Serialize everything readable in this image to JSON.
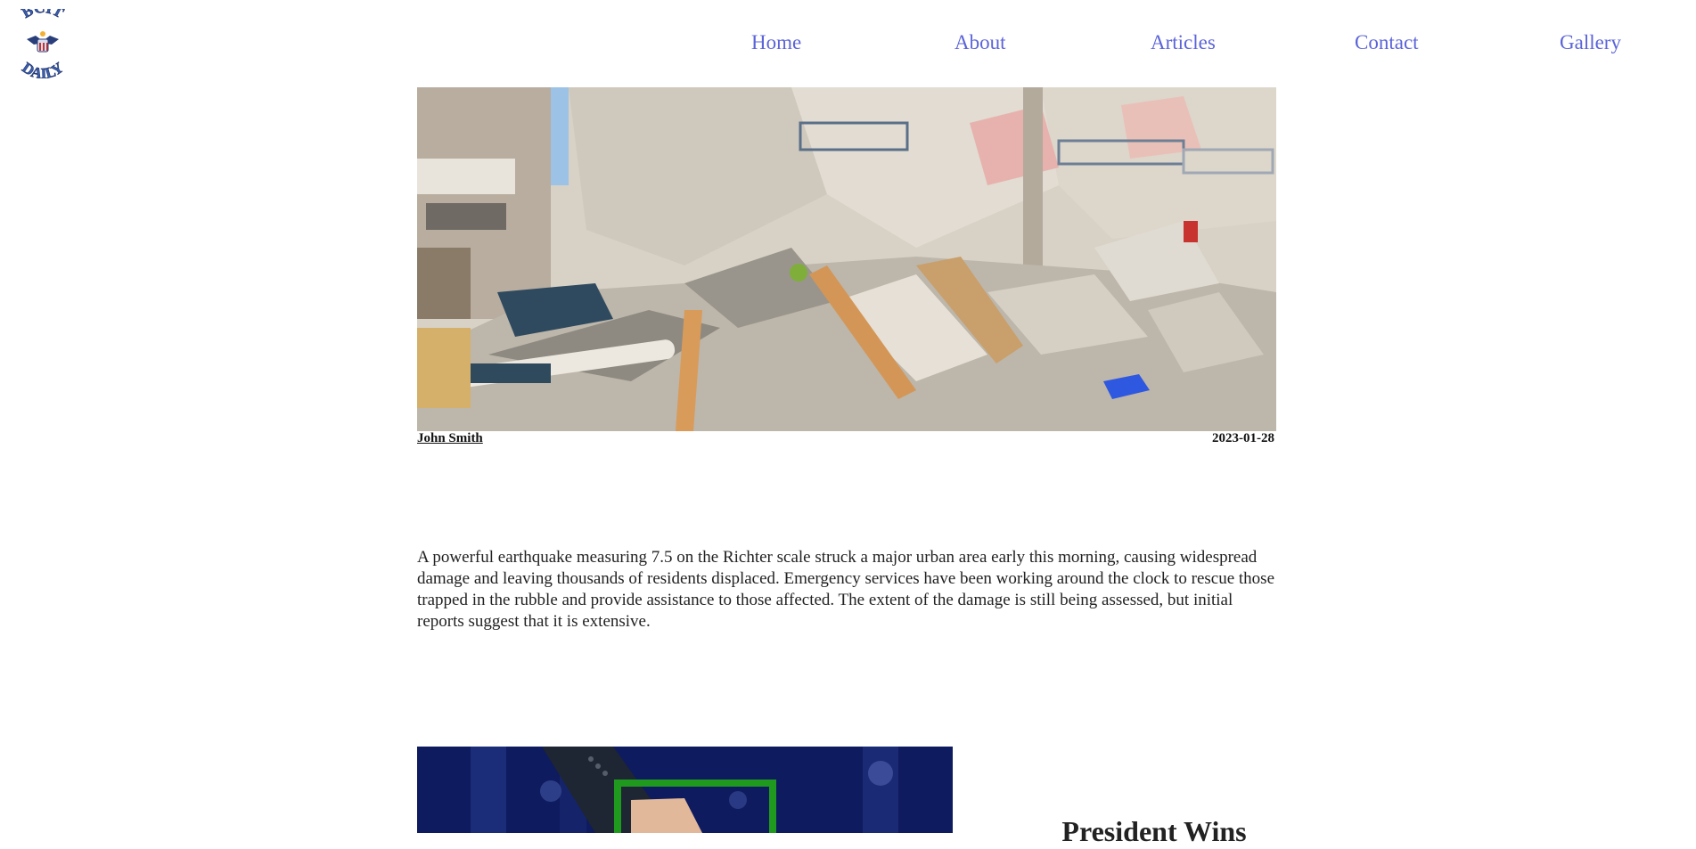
{
  "header": {
    "logo_text_top": "BCIT",
    "logo_text_bottom": "DAILY",
    "nav": [
      {
        "label": "Home"
      },
      {
        "label": "About"
      },
      {
        "label": "Articles"
      },
      {
        "label": "Contact"
      },
      {
        "label": "Gallery"
      }
    ]
  },
  "main_article": {
    "image_icon": "earthquake-rubble-photo",
    "author": "John Smith",
    "date": "2023-01-28",
    "body": "A powerful earthquake measuring 7.5 on the Richter scale struck a major urban area early this morning, causing widespread damage and leaving thousands of residents displaced. Emergency services have been working around the clock to rescue those trapped in the rubble and provide assistance to those affected. The extent of the damage is still being assessed, but initial reports suggest that it is extensive."
  },
  "second_article": {
    "image_icon": "president-handshake-photo",
    "title": "President Wins"
  },
  "colors": {
    "nav_link": "#5b64d8",
    "logo_blue": "#3a5fb0",
    "accent_green": "#1f9a1f"
  }
}
